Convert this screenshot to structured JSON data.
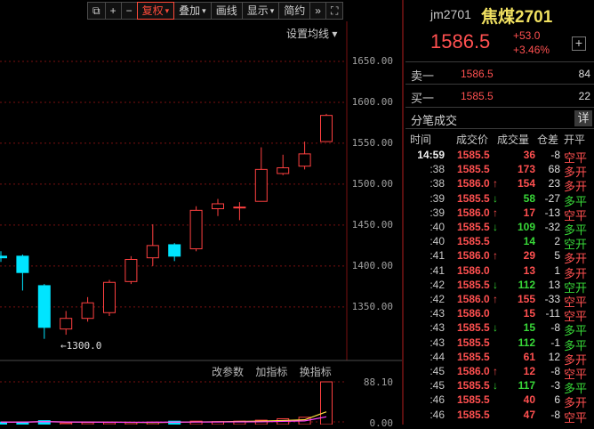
{
  "toolbar": {
    "items": [
      {
        "name": "lock-icon",
        "label": "⧉",
        "active": false
      },
      {
        "name": "add-button",
        "label": "+",
        "active": false
      },
      {
        "name": "minus-button",
        "label": "−",
        "active": false
      },
      {
        "name": "fuquan-dropdown",
        "label": "复权",
        "caret": true,
        "active": true
      },
      {
        "name": "overlay-dropdown",
        "label": "叠加",
        "caret": true,
        "active": false
      },
      {
        "name": "draw-line-button",
        "label": "画线",
        "active": false
      },
      {
        "name": "display-dropdown",
        "label": "显示",
        "caret": true,
        "active": false
      },
      {
        "name": "simple-button",
        "label": "简约",
        "active": false
      },
      {
        "name": "more-icon",
        "label": "»",
        "active": false
      },
      {
        "name": "fullscreen-icon",
        "label": "⛶",
        "active": false
      }
    ]
  },
  "chart": {
    "ma_setting_label": "设置均线 ▾",
    "min_label": "←1300.0",
    "price_ticks": [
      "1650.00",
      "1600.00",
      "1550.00",
      "1500.00",
      "1450.00",
      "1400.00",
      "1350.00"
    ],
    "indicator_buttons": [
      "改参数",
      "加指标",
      "换指标"
    ],
    "vol_ticks": [
      "88.10",
      "0.00"
    ],
    "colors": {
      "up": "#ff4040",
      "down": "#00e5ff",
      "grid": "#7a1010"
    }
  },
  "chart_data": {
    "type": "candlestick",
    "ylim": [
      1290,
      1675
    ],
    "candles": [
      {
        "o": 1412,
        "h": 1418,
        "l": 1405,
        "c": 1410
      },
      {
        "o": 1412,
        "h": 1414,
        "l": 1370,
        "c": 1392
      },
      {
        "o": 1376,
        "h": 1378,
        "l": 1311,
        "c": 1325
      },
      {
        "o": 1323,
        "h": 1345,
        "l": 1316,
        "c": 1336
      },
      {
        "o": 1336,
        "h": 1362,
        "l": 1332,
        "c": 1355
      },
      {
        "o": 1343,
        "h": 1383,
        "l": 1339,
        "c": 1380
      },
      {
        "o": 1381,
        "h": 1412,
        "l": 1378,
        "c": 1408
      },
      {
        "o": 1410,
        "h": 1451,
        "l": 1400,
        "c": 1425
      },
      {
        "o": 1426,
        "h": 1428,
        "l": 1406,
        "c": 1412
      },
      {
        "o": 1421,
        "h": 1473,
        "l": 1418,
        "c": 1468
      },
      {
        "o": 1470,
        "h": 1482,
        "l": 1461,
        "c": 1476
      },
      {
        "o": 1472,
        "h": 1478,
        "l": 1456,
        "c": 1472
      },
      {
        "o": 1479,
        "h": 1545,
        "l": 1479,
        "c": 1518
      },
      {
        "o": 1513,
        "h": 1536,
        "l": 1511,
        "c": 1520
      },
      {
        "o": 1522,
        "h": 1552,
        "l": 1518,
        "c": 1537
      },
      {
        "o": 1552,
        "h": 1586,
        "l": 1552,
        "c": 1584
      }
    ],
    "volumes": [
      5,
      5,
      8,
      3,
      4,
      4,
      4,
      5,
      7,
      7,
      6,
      7,
      9,
      12,
      15,
      88.1
    ]
  },
  "quote": {
    "code": "jm2701",
    "name": "焦煤2701",
    "price": "1586.5",
    "change": "+53.0",
    "change_pct": "+3.46%",
    "plus_label": "+"
  },
  "orderbook": [
    {
      "label": "卖一",
      "price": "1586.5",
      "vol": "84"
    },
    {
      "label": "买一",
      "price": "1585.5",
      "vol": "22"
    }
  ],
  "ticks_panel": {
    "title": "分笔成交",
    "detail_label": "详",
    "headers": {
      "time": "时间",
      "price": "成交价",
      "vol": "成交量",
      "oi": "仓差",
      "type": "开平"
    },
    "rows": [
      {
        "time": "14:59",
        "price": "1585.5",
        "arrow": "",
        "pc": "red",
        "vol": "36",
        "vc": "red",
        "oi": "-8",
        "type": "空平",
        "tc": "red"
      },
      {
        "time": ":38",
        "price": "1585.5",
        "arrow": "",
        "pc": "red",
        "vol": "173",
        "vc": "red",
        "oi": "68",
        "type": "多开",
        "tc": "red"
      },
      {
        "time": ":38",
        "price": "1586.0",
        "arrow": "↑",
        "pc": "red",
        "vol": "154",
        "vc": "red",
        "oi": "23",
        "type": "多开",
        "tc": "red"
      },
      {
        "time": ":39",
        "price": "1585.5",
        "arrow": "↓",
        "pc": "red",
        "vol": "58",
        "vc": "green",
        "oi": "-27",
        "type": "多平",
        "tc": "green"
      },
      {
        "time": ":39",
        "price": "1586.0",
        "arrow": "↑",
        "pc": "red",
        "vol": "17",
        "vc": "red",
        "oi": "-13",
        "type": "空平",
        "tc": "red"
      },
      {
        "time": ":40",
        "price": "1585.5",
        "arrow": "↓",
        "pc": "red",
        "vol": "109",
        "vc": "green",
        "oi": "-32",
        "type": "多平",
        "tc": "green"
      },
      {
        "time": ":40",
        "price": "1585.5",
        "arrow": "",
        "pc": "red",
        "vol": "14",
        "vc": "green",
        "oi": "2",
        "type": "空开",
        "tc": "green"
      },
      {
        "time": ":41",
        "price": "1586.0",
        "arrow": "↑",
        "pc": "red",
        "vol": "29",
        "vc": "red",
        "oi": "5",
        "type": "多开",
        "tc": "red"
      },
      {
        "time": ":41",
        "price": "1586.0",
        "arrow": "",
        "pc": "red",
        "vol": "13",
        "vc": "red",
        "oi": "1",
        "type": "多开",
        "tc": "red"
      },
      {
        "time": ":42",
        "price": "1585.5",
        "arrow": "↓",
        "pc": "red",
        "vol": "112",
        "vc": "green",
        "oi": "13",
        "type": "空开",
        "tc": "green"
      },
      {
        "time": ":42",
        "price": "1586.0",
        "arrow": "↑",
        "pc": "red",
        "vol": "155",
        "vc": "red",
        "oi": "-33",
        "type": "空平",
        "tc": "red"
      },
      {
        "time": ":43",
        "price": "1586.0",
        "arrow": "",
        "pc": "red",
        "vol": "15",
        "vc": "red",
        "oi": "-11",
        "type": "空平",
        "tc": "red"
      },
      {
        "time": ":43",
        "price": "1585.5",
        "arrow": "↓",
        "pc": "red",
        "vol": "15",
        "vc": "green",
        "oi": "-8",
        "type": "多平",
        "tc": "green"
      },
      {
        "time": ":43",
        "price": "1585.5",
        "arrow": "",
        "pc": "red",
        "vol": "112",
        "vc": "green",
        "oi": "-1",
        "type": "多平",
        "tc": "green"
      },
      {
        "time": ":44",
        "price": "1585.5",
        "arrow": "",
        "pc": "red",
        "vol": "61",
        "vc": "red",
        "oi": "12",
        "type": "多开",
        "tc": "red"
      },
      {
        "time": ":45",
        "price": "1586.0",
        "arrow": "↑",
        "pc": "red",
        "vol": "12",
        "vc": "red",
        "oi": "-8",
        "type": "空平",
        "tc": "red"
      },
      {
        "time": ":45",
        "price": "1585.5",
        "arrow": "↓",
        "pc": "red",
        "vol": "117",
        "vc": "green",
        "oi": "-3",
        "type": "多平",
        "tc": "green"
      },
      {
        "time": ":46",
        "price": "1585.5",
        "arrow": "",
        "pc": "red",
        "vol": "40",
        "vc": "red",
        "oi": "6",
        "type": "多开",
        "tc": "red"
      },
      {
        "time": ":46",
        "price": "1585.5",
        "arrow": "",
        "pc": "red",
        "vol": "47",
        "vc": "red",
        "oi": "-8",
        "type": "空平",
        "tc": "red"
      }
    ]
  }
}
